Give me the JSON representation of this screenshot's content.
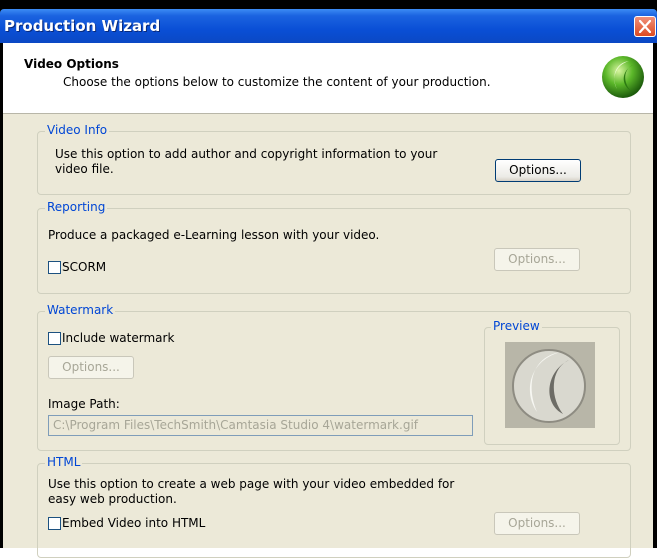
{
  "window": {
    "title": "Production Wizard"
  },
  "header": {
    "title": "Video Options",
    "subtitle": "Choose the options below to customize the content of your production."
  },
  "video_info": {
    "legend": "Video Info",
    "description_line1": "Use this option to add author and copyright information to your",
    "description_line2": "video file.",
    "options_button": "Options..."
  },
  "reporting": {
    "legend": "Reporting",
    "description": "Produce a packaged  e-Learning lesson with your video.",
    "scorm_label": "SCORM",
    "scorm_checked": false,
    "options_button": "Options..."
  },
  "watermark": {
    "legend": "Watermark",
    "include_label": "Include watermark",
    "include_checked": false,
    "options_button": "Options...",
    "image_path_label": "Image Path:",
    "image_path_value": "C:\\Program Files\\TechSmith\\Camtasia Studio 4\\watermark.gif",
    "preview_legend": "Preview"
  },
  "html": {
    "legend": "HTML",
    "description_line1": "Use this option to create a web page with your video embedded for",
    "description_line2": "easy web production.",
    "embed_label": "Embed Video into HTML",
    "embed_checked": false,
    "options_button": "Options..."
  },
  "colors": {
    "title_bar": "#0a4fd6",
    "legend_text": "#0046d5",
    "dialog_bg": "#ece9d8"
  },
  "icons": [
    "close-icon",
    "camtasia-logo-icon",
    "watermark-preview-image"
  ]
}
